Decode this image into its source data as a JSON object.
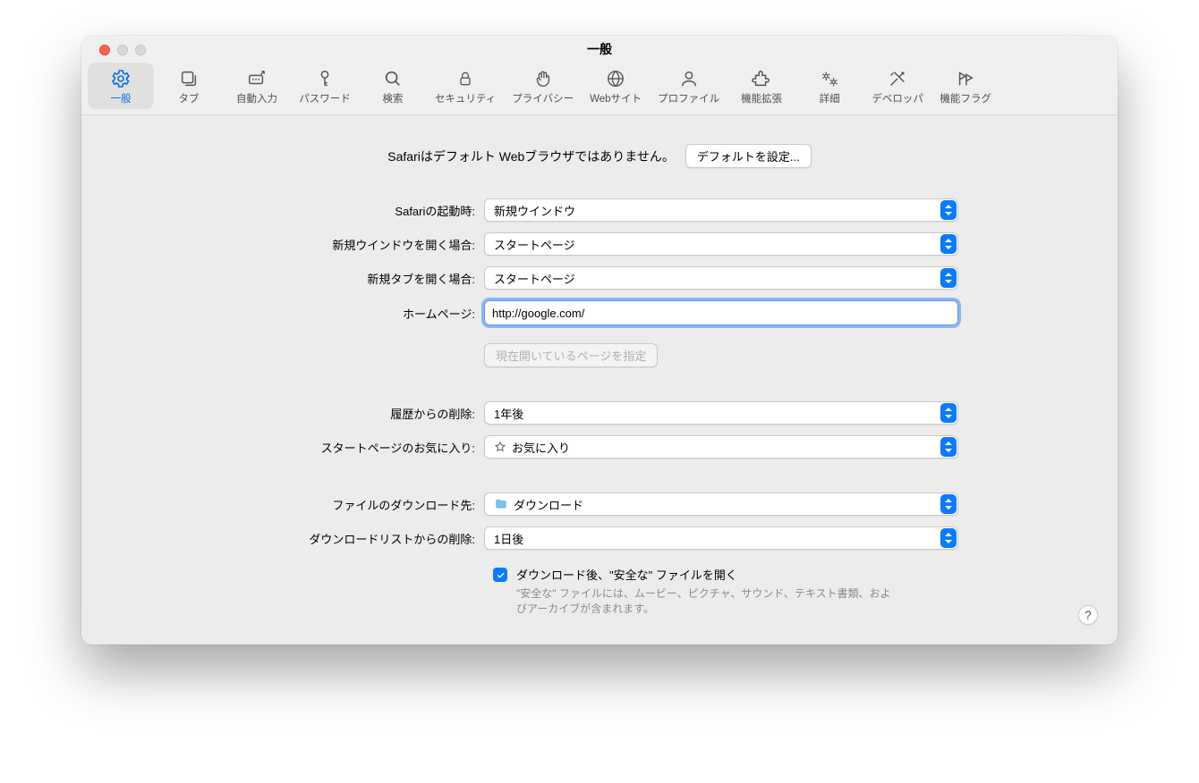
{
  "window": {
    "title": "一般"
  },
  "toolbar": {
    "tabs": [
      {
        "label": "一般"
      },
      {
        "label": "タブ"
      },
      {
        "label": "自動入力"
      },
      {
        "label": "パスワード"
      },
      {
        "label": "検索"
      },
      {
        "label": "セキュリティ"
      },
      {
        "label": "プライバシー"
      },
      {
        "label": "Webサイト"
      },
      {
        "label": "プロファイル"
      },
      {
        "label": "機能拡張"
      },
      {
        "label": "詳細"
      },
      {
        "label": "デベロッパ"
      },
      {
        "label": "機能フラグ"
      }
    ]
  },
  "notice": {
    "text": "Safariはデフォルト Webブラウザではありません。",
    "button": "デフォルトを設定..."
  },
  "form": {
    "startup": {
      "label": "Safariの起動時:",
      "value": "新規ウインドウ"
    },
    "newWindow": {
      "label": "新規ウインドウを開く場合:",
      "value": "スタートページ"
    },
    "newTab": {
      "label": "新規タブを開く場合:",
      "value": "スタートページ"
    },
    "homepage": {
      "label": "ホームページ:",
      "value": "http://google.com/"
    },
    "setCurrentBtn": "現在開いているページを指定",
    "historyRemove": {
      "label": "履歴からの削除:",
      "value": "1年後"
    },
    "favorites": {
      "label": "スタートページのお気に入り:",
      "value": "お気に入り"
    },
    "downloadDest": {
      "label": "ファイルのダウンロード先:",
      "value": "ダウンロード"
    },
    "downloadRemove": {
      "label": "ダウンロードリストからの削除:",
      "value": "1日後"
    },
    "safeFiles": {
      "title": "ダウンロード後、\"安全な\" ファイルを開く",
      "sub": "\"安全な\" ファイルには、ムービー、ピクチャ、サウンド、テキスト書類、およびアーカイブが含まれます。"
    }
  },
  "help": "?"
}
